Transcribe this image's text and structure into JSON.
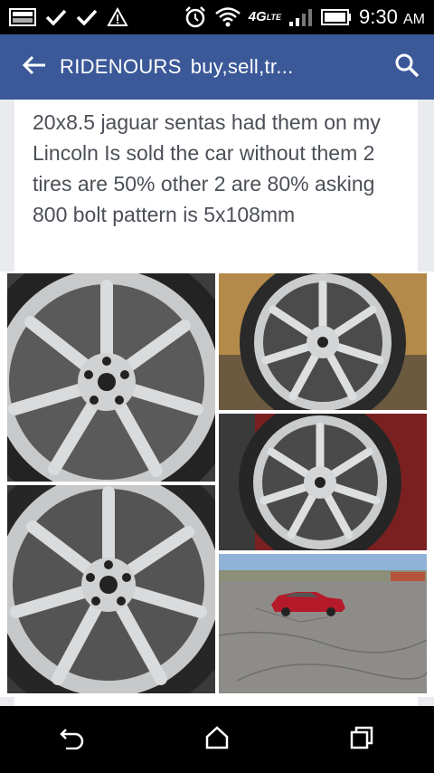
{
  "status_bar": {
    "time": "9:30",
    "ampm": "AM",
    "network": "4G",
    "network_sub": "LTE"
  },
  "app_bar": {
    "group_name": "RIDENOURS",
    "group_subtitle": "buy,sell,tr...",
    "back_icon": "arrow-left-icon",
    "search_icon": "search-icon",
    "color": "#3b5998"
  },
  "post": {
    "text": "20x8.5 jaguar sentas had them on my Lincoln Is sold the car without them 2 tires are 50% other 2 are 80% asking 800 bolt pattern is 5x108mm"
  },
  "photos": [
    {
      "name": "wheel-photo-1"
    },
    {
      "name": "wheel-photo-2"
    },
    {
      "name": "wheel-photo-3"
    },
    {
      "name": "wheel-photo-4"
    },
    {
      "name": "car-photo"
    }
  ],
  "nav_bar": {
    "back_icon": "nav-back-icon",
    "home_icon": "home-icon",
    "recents_icon": "recents-icon"
  }
}
